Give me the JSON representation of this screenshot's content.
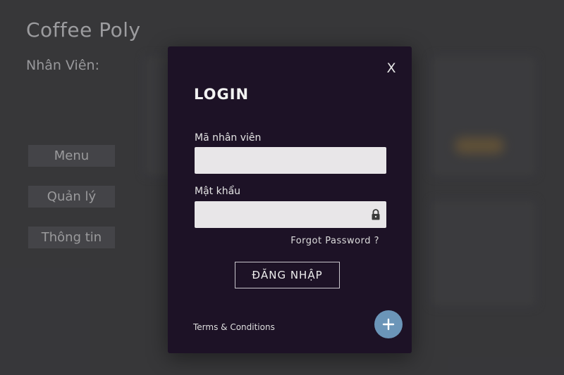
{
  "app": {
    "title": "Coffee Poly",
    "staff_label": "Nhân Viên:"
  },
  "sidebar": {
    "items": [
      {
        "label": "Menu"
      },
      {
        "label": "Quản lý"
      },
      {
        "label": "Thông tin"
      }
    ]
  },
  "login_modal": {
    "close_label": "X",
    "title": "LOGIN",
    "employee_id_label": "Mã nhân viên",
    "employee_id_value": "",
    "password_label": "Mật khẩu",
    "password_value": "",
    "password_icon": "lock-icon",
    "forgot_password": "Forgot Password ?",
    "submit_label": "ĐĂNG NHẬP",
    "terms_link": "Terms & Conditions",
    "fab_icon": "plus-icon"
  },
  "colors": {
    "modal_background": "#1d1226",
    "fab_background": "#6b95b8",
    "input_background": "#e8e6e8"
  }
}
